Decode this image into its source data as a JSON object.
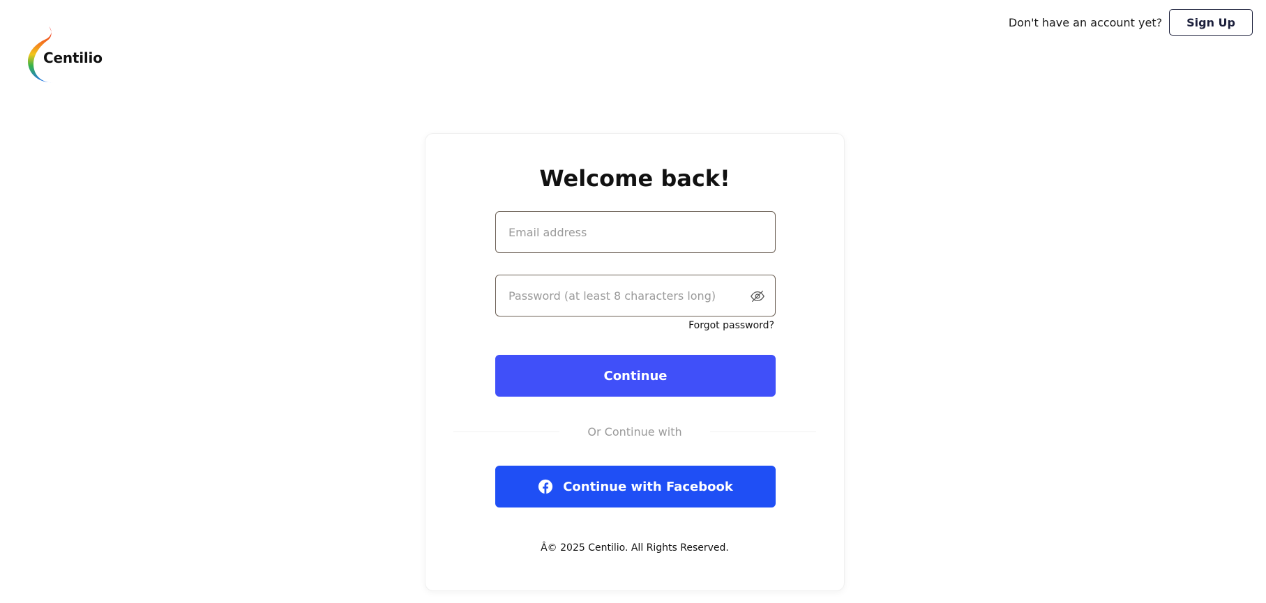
{
  "header": {
    "brand_name": "Centilio",
    "signup_prompt": "Don't have an account yet?",
    "signup_label": "Sign Up"
  },
  "login": {
    "title": "Welcome back!",
    "email_placeholder": "Email address",
    "email_value": "",
    "password_placeholder": "Password (at least 8 characters long)",
    "password_value": "",
    "password_toggle_icon": "eye-slash-icon",
    "forgot_label": "Forgot password?",
    "continue_label": "Continue",
    "divider_text": "Or Continue with",
    "facebook_label": "Continue with Facebook",
    "facebook_icon": "facebook-icon",
    "copyright": "Â© 2025 Centilio. All Rights Reserved."
  },
  "colors": {
    "primary": "#4050f9",
    "facebook": "#1f4ff5",
    "field_border": "#6b5f54",
    "signup_border": "#1b1f3b"
  }
}
